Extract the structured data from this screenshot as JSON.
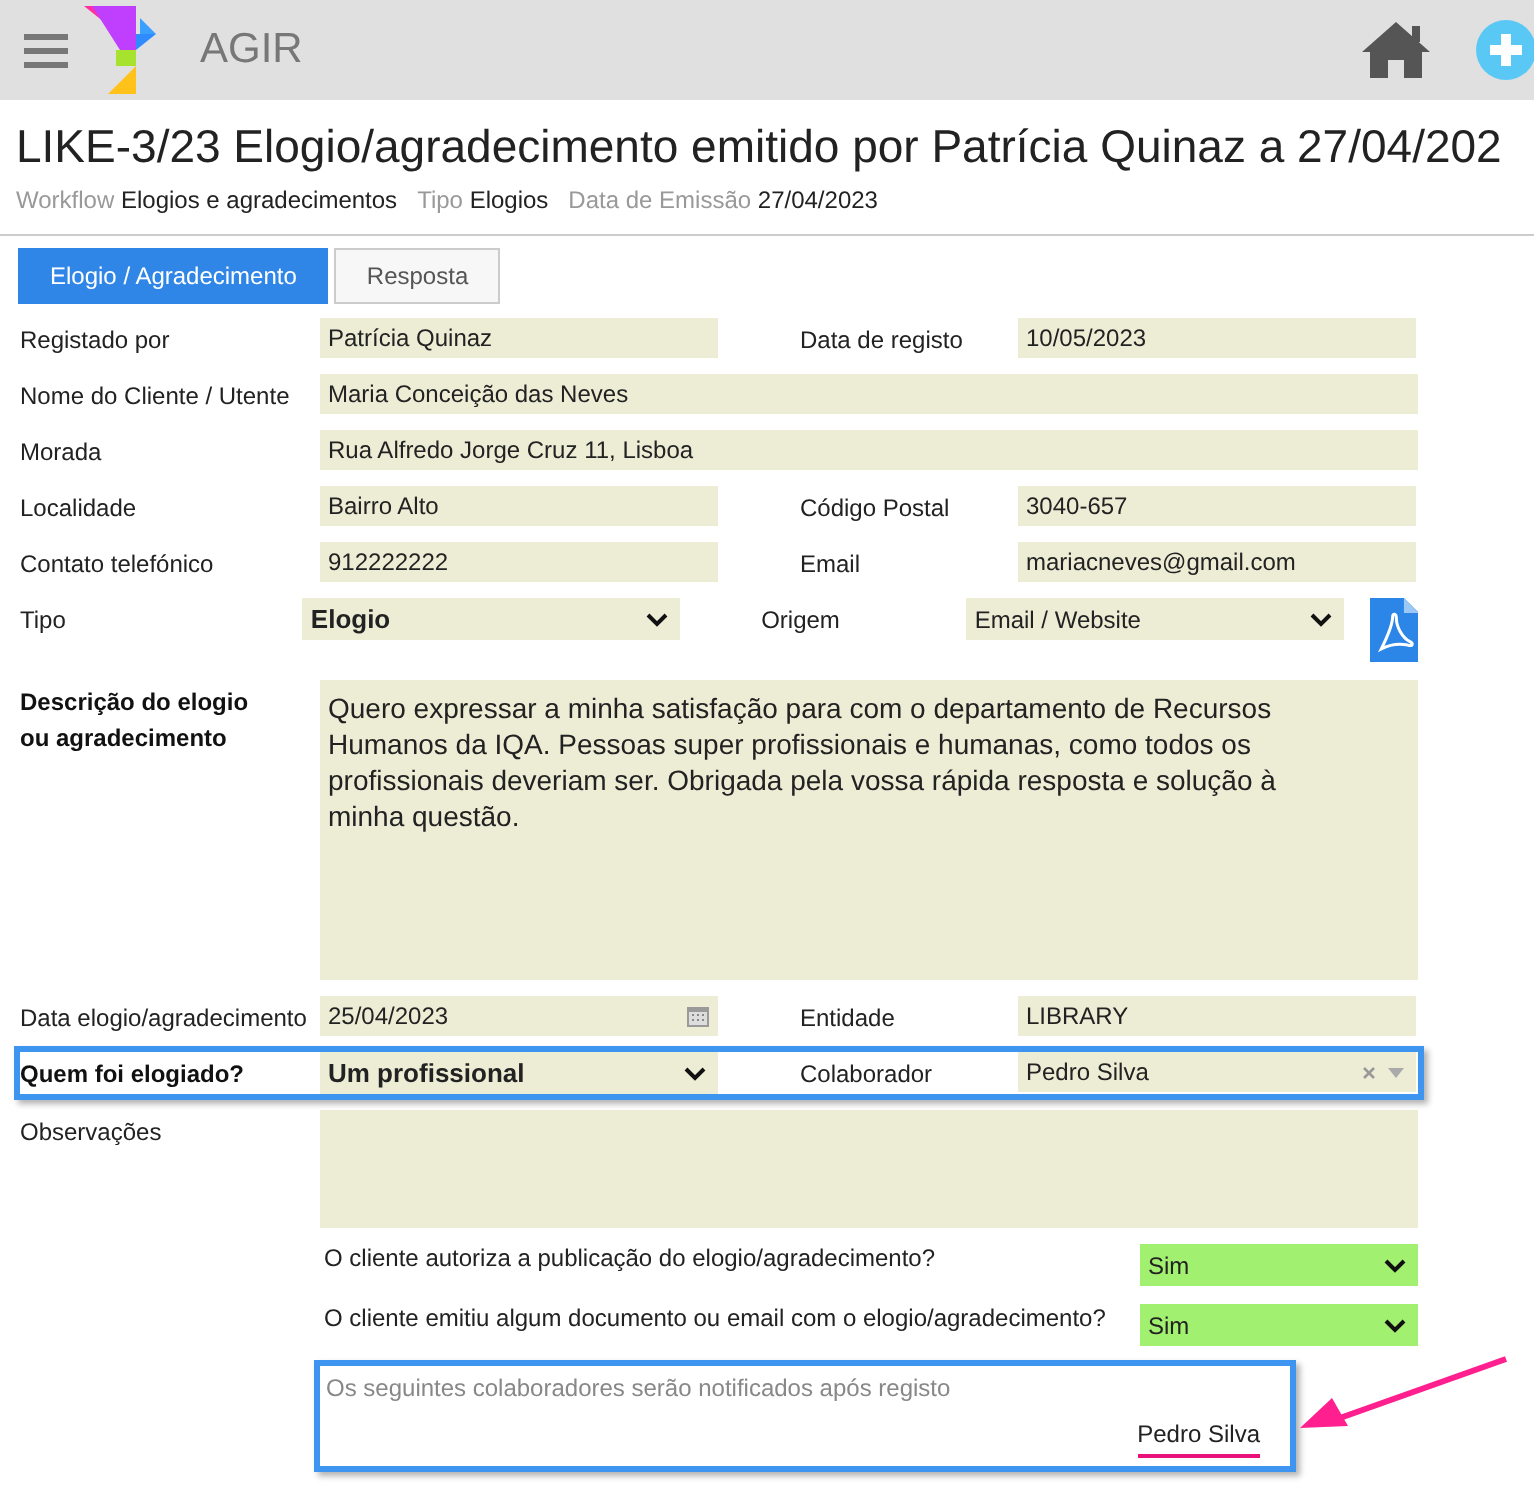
{
  "header": {
    "app_name": "AGIR"
  },
  "title": "LIKE-3/23 Elogio/agradecimento emitido por Patrícia Quinaz a 27/04/202",
  "meta": [
    {
      "label": "Workflow",
      "value": "Elogios e agradecimentos"
    },
    {
      "label": "Tipo",
      "value": "Elogios"
    },
    {
      "label": "Data de Emissão",
      "value": "27/04/2023"
    }
  ],
  "tabs": [
    {
      "label": "Elogio / Agradecimento",
      "selected": true
    },
    {
      "label": "Resposta",
      "selected": false
    }
  ],
  "rows": [
    {
      "highlighted": false,
      "fields": [
        {
          "label": "Registado por",
          "kind": "text",
          "value": "Patrícia Quinaz"
        },
        {
          "label": "Data de registo",
          "kind": "text",
          "value": "10/05/2023"
        }
      ]
    },
    {
      "highlighted": false,
      "fields": [
        {
          "label": "Nome do Cliente / Utente",
          "kind": "text",
          "value": "Maria Conceição das Neves"
        }
      ]
    },
    {
      "highlighted": false,
      "fields": [
        {
          "label": "Morada",
          "kind": "text",
          "value": "Rua Alfredo Jorge Cruz 11, Lisboa"
        }
      ]
    },
    {
      "highlighted": false,
      "fields": [
        {
          "label": "Localidade",
          "kind": "text",
          "value": "Bairro Alto"
        },
        {
          "label": "Código Postal",
          "kind": "text",
          "value": "3040-657"
        }
      ]
    },
    {
      "highlighted": false,
      "fields": [
        {
          "label": "Contato telefónico",
          "kind": "text",
          "value": "912222222"
        },
        {
          "label": "Email",
          "kind": "text",
          "value": "mariacneves@gmail.com"
        }
      ]
    },
    {
      "highlighted": false,
      "pdf": true,
      "fields": [
        {
          "label": "Tipo",
          "kind": "select",
          "value": "Elogio",
          "bold_value": true
        },
        {
          "label": "Origem",
          "kind": "select",
          "value": "Email / Website",
          "bold_value": false
        }
      ]
    },
    {
      "highlighted": false,
      "fields": [
        {
          "label": "Descrição do elogio ou agradecimento",
          "kind": "textarea",
          "bold_label": true,
          "value": "Quero expressar a minha satisfação para com o departamento de Recursos Humanos da IQA. Pessoas super profissionais e humanas, como todos os profissionais deveriam ser. Obrigada pela vossa rápida resposta e solução à minha questão."
        }
      ]
    },
    {
      "highlighted": false,
      "fields": [
        {
          "label": "Data elogio/agradecimento",
          "kind": "date",
          "value": "25/04/2023"
        },
        {
          "label": "Entidade",
          "kind": "text",
          "value": "LIBRARY"
        }
      ]
    },
    {
      "highlighted": true,
      "fields": [
        {
          "label": "Quem foi elogiado?",
          "kind": "select",
          "bold_label": true,
          "value": "Um profissional",
          "bold_value": true
        },
        {
          "label": "Colaborador",
          "kind": "combo",
          "value": "Pedro Silva"
        }
      ]
    },
    {
      "highlighted": false,
      "fields": [
        {
          "label": "Observações",
          "kind": "notes"
        }
      ]
    }
  ],
  "questions": [
    {
      "text": "O cliente autoriza a publicação do elogio/agradecimento?",
      "value": "Sim"
    },
    {
      "text": "O cliente emitiu algum documento ou email com o elogio/agradecimento?",
      "value": "Sim"
    }
  ],
  "notification": {
    "placeholder": "Os seguintes colaboradores serão notificados após registo",
    "names": [
      "Pedro Silva"
    ]
  }
}
